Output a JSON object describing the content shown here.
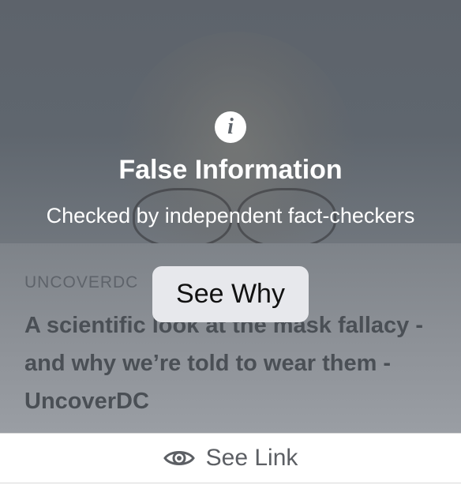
{
  "overlay": {
    "icon": "info-icon",
    "icon_glyph": "i",
    "title": "False Information",
    "subtitle": "Checked by independent fact-checkers",
    "button_label": "See Why"
  },
  "preview": {
    "domain": "UNCOVERDC",
    "headline": "A scientific look at the mask fallacy - and why we’re told to wear them - UncoverDC"
  },
  "footer": {
    "icon": "eye-icon",
    "label": "See Link"
  },
  "colors": {
    "overlay_text": "#ffffff",
    "button_bg": "#e7e8ec",
    "link_text": "#5c5f64"
  }
}
